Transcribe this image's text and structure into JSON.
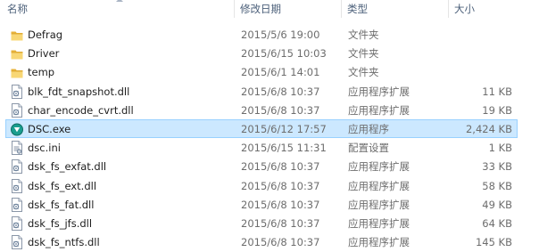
{
  "columns": {
    "name": "名称",
    "date": "修改日期",
    "type": "类型",
    "size": "大小"
  },
  "files": [
    {
      "name": "Defrag",
      "date": "2015/5/6 19:00",
      "type": "文件夹",
      "size": "",
      "icon": "folder-icon"
    },
    {
      "name": "Driver",
      "date": "2015/6/15 10:03",
      "type": "文件夹",
      "size": "",
      "icon": "folder-icon"
    },
    {
      "name": "temp",
      "date": "2015/6/1 14:01",
      "type": "文件夹",
      "size": "",
      "icon": "folder-icon"
    },
    {
      "name": "blk_fdt_snapshot.dll",
      "date": "2015/6/8 10:37",
      "type": "应用程序扩展",
      "size": "11 KB",
      "icon": "dll-file-icon"
    },
    {
      "name": "char_encode_cvrt.dll",
      "date": "2015/6/8 10:37",
      "type": "应用程序扩展",
      "size": "19 KB",
      "icon": "dll-file-icon"
    },
    {
      "name": "DSC.exe",
      "date": "2015/6/12 17:57",
      "type": "应用程序",
      "size": "2,424 KB",
      "icon": "app-exe-icon",
      "selected": true
    },
    {
      "name": "dsc.ini",
      "date": "2015/6/15 11:31",
      "type": "配置设置",
      "size": "1 KB",
      "icon": "ini-file-icon"
    },
    {
      "name": "dsk_fs_exfat.dll",
      "date": "2015/6/8 10:37",
      "type": "应用程序扩展",
      "size": "33 KB",
      "icon": "dll-file-icon"
    },
    {
      "name": "dsk_fs_ext.dll",
      "date": "2015/6/8 10:37",
      "type": "应用程序扩展",
      "size": "58 KB",
      "icon": "dll-file-icon"
    },
    {
      "name": "dsk_fs_fat.dll",
      "date": "2015/6/8 10:37",
      "type": "应用程序扩展",
      "size": "49 KB",
      "icon": "dll-file-icon"
    },
    {
      "name": "dsk_fs_jfs.dll",
      "date": "2015/6/8 10:37",
      "type": "应用程序扩展",
      "size": "64 KB",
      "icon": "dll-file-icon"
    },
    {
      "name": "dsk_fs_ntfs.dll",
      "date": "2015/6/8 10:37",
      "type": "应用程序扩展",
      "size": "145 KB",
      "icon": "dll-file-icon"
    }
  ],
  "colors": {
    "selection_bg": "#cce8ff",
    "selection_border": "#99d1ff",
    "folder": "#f4c84a",
    "header_text": "#4c607a"
  }
}
